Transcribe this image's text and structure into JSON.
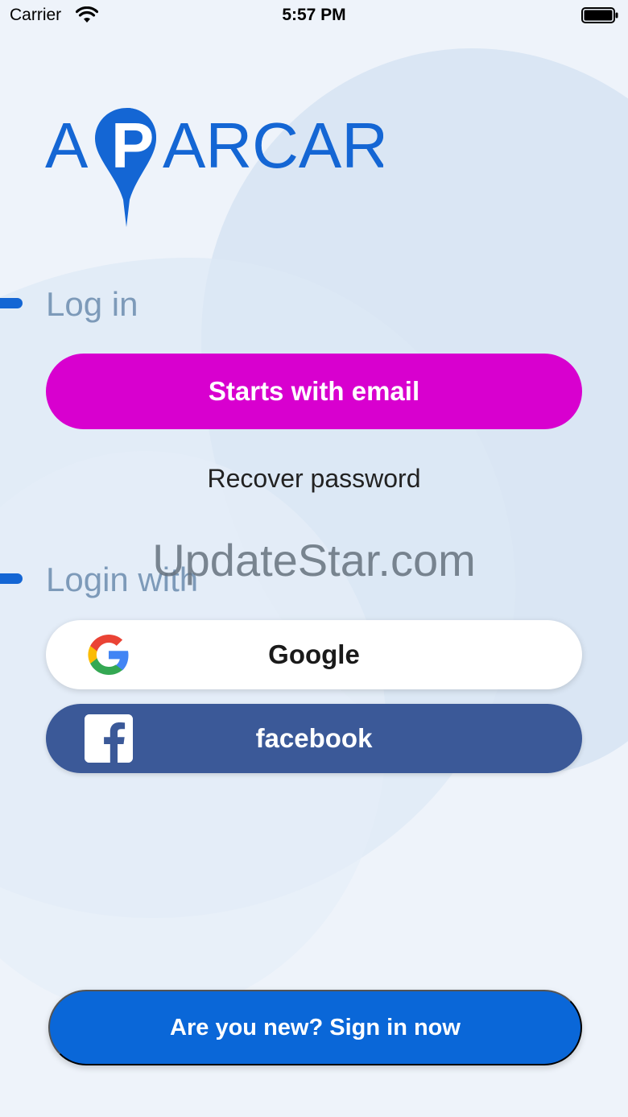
{
  "status_bar": {
    "carrier": "Carrier",
    "time": "5:57 PM"
  },
  "logo": {
    "text_before_pin": "A",
    "pin_letter": "P",
    "text_after_pin": "ARCAR",
    "color": "#1466d4"
  },
  "login_section": {
    "title": "Log in",
    "email_button": "Starts with email",
    "recover_password": "Recover password"
  },
  "social_section": {
    "title": "Login with",
    "google_button": "Google",
    "facebook_button": "facebook"
  },
  "signup_button": "Are you new? Sign in now",
  "watermark": "UpdateStar.com",
  "colors": {
    "email_button": "#d800cf",
    "facebook": "#3b5998",
    "signup_button": "#0a67d8",
    "section_title": "#7d9ab9"
  },
  "icons": [
    "wifi-icon",
    "battery-icon",
    "location-pin-icon",
    "google-icon",
    "facebook-icon"
  ]
}
